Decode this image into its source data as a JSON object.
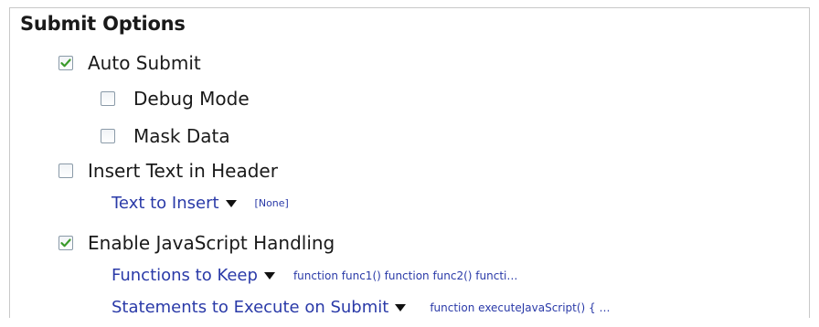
{
  "section": {
    "title": "Submit Options"
  },
  "options": {
    "auto_submit": {
      "label": "Auto Submit",
      "checked": true
    },
    "debug_mode": {
      "label": "Debug Mode",
      "checked": false
    },
    "mask_data": {
      "label": "Mask Data",
      "checked": false
    },
    "insert_text_header": {
      "label": "Insert Text in Header",
      "checked": false
    },
    "enable_js": {
      "label": "Enable JavaScript Handling",
      "checked": true
    }
  },
  "properties": {
    "text_to_insert": {
      "label": "Text to Insert",
      "value": "[None]"
    },
    "functions_to_keep": {
      "label": "Functions to Keep",
      "value": "function func1() function func2() functi…"
    },
    "statements_on_submit": {
      "label": "Statements to Execute on Submit",
      "value": "function executeJavaScript() { …"
    }
  },
  "colors": {
    "check": "#3a9a2a",
    "link": "#2a3aa8",
    "border": "#8a9aa8"
  }
}
